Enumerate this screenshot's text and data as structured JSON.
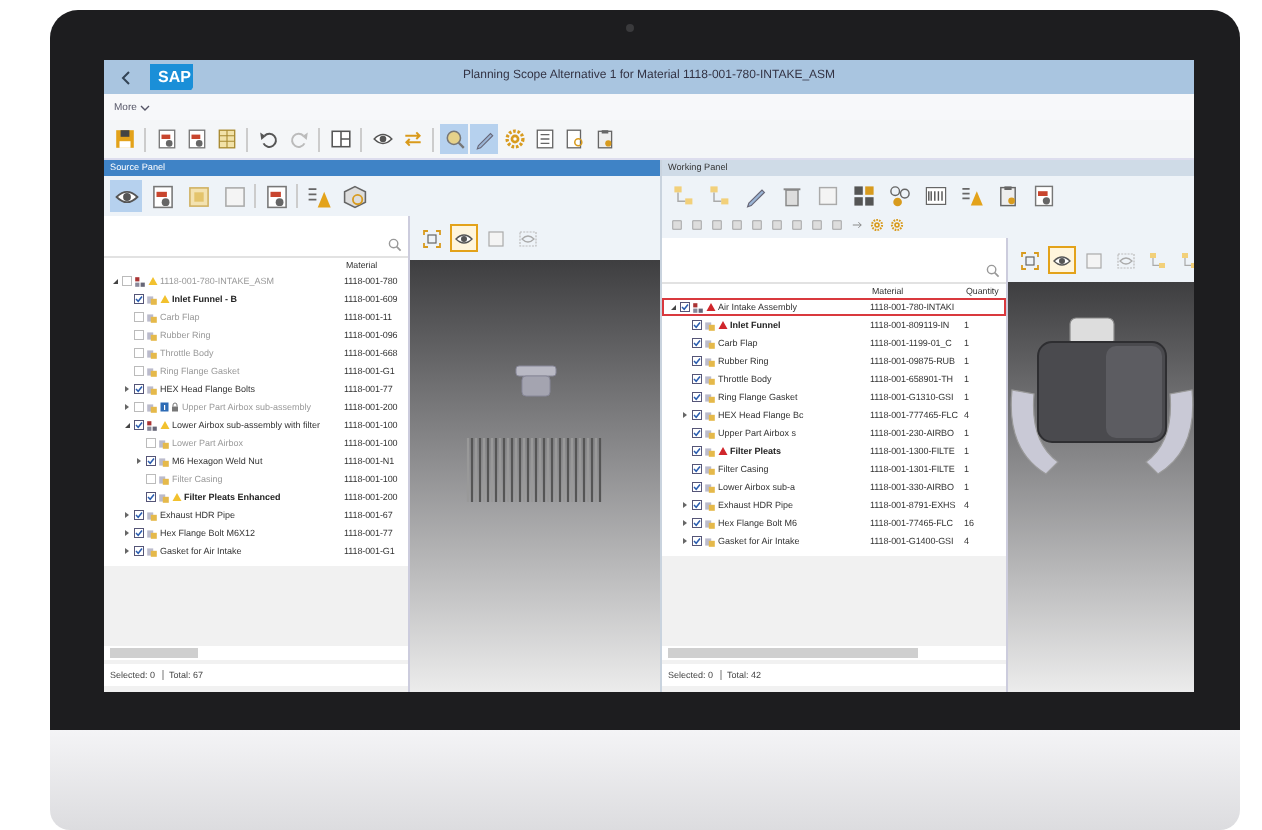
{
  "header": {
    "logo": "SAP",
    "title": "Planning Scope Alternative 1 for Material 1118-001-780-INTAKE_ASM"
  },
  "menu": {
    "more": "More"
  },
  "main_toolbar": [
    {
      "pressed": false
    },
    {
      "pressed": false
    },
    {
      "pressed": false
    },
    {
      "pressed": false
    },
    {
      "pressed": false
    },
    {
      "pressed": false
    },
    {
      "pressed": false
    },
    {
      "pressed": false
    },
    {
      "pressed": false
    },
    {
      "pressed": true
    },
    {
      "pressed": true
    },
    {
      "pressed": false
    },
    {
      "pressed": false
    },
    {
      "pressed": false
    },
    {
      "pressed": false
    }
  ],
  "source_panel": {
    "title": "Source Panel",
    "active": true,
    "toolbar": [
      {
        "pressed": true
      },
      {
        "pressed": false
      },
      {
        "pressed": false
      },
      {
        "pressed": false
      },
      {
        "pressed": false
      },
      {
        "pressed": false
      },
      {
        "pressed": false
      }
    ],
    "viewer_toolbar": [
      {
        "pressed": false
      },
      {
        "pressed": true
      },
      {
        "pressed": false
      },
      {
        "pressed": false
      }
    ],
    "columns": [
      "Material"
    ],
    "rows": [
      {
        "label": "1118-001-780-INTAKE_ASM",
        "material": "1118-001-780",
        "checked": false,
        "kind": "warning",
        "expanded": true,
        "children": [
          {
            "label": "Inlet Funnel - B",
            "material": "1118-001-609",
            "checked": true,
            "kind": "warning"
          },
          {
            "label": "Carb Flap",
            "material": "1118-001-11",
            "checked": false,
            "kind": "none"
          },
          {
            "label": "Rubber Ring",
            "material": "1118-001-096",
            "checked": false,
            "kind": "none"
          },
          {
            "label": "Throttle Body",
            "material": "1118-001-668",
            "checked": false,
            "kind": "none"
          },
          {
            "label": "Ring Flange Gasket",
            "material": "1118-001-G1",
            "checked": false,
            "kind": "none"
          },
          {
            "label": "HEX Head Flange Bolts",
            "material": "1118-001-77",
            "checked": true,
            "kind": "none",
            "expanded": false
          },
          {
            "label": "Upper Part Airbox sub-assembly",
            "material": "1118-001-200",
            "checked": false,
            "kind": "locked",
            "expanded": false
          },
          {
            "label": "Lower Airbox sub-assembly with filter",
            "material": "1118-001-100",
            "checked": true,
            "kind": "warning",
            "expanded": true,
            "children": [
              {
                "label": "Lower Part Airbox",
                "material": "1118-001-100",
                "checked": false,
                "kind": "none"
              },
              {
                "label": "M6 Hexagon Weld Nut",
                "material": "1118-001-N1",
                "checked": true,
                "kind": "none",
                "expanded": false
              },
              {
                "label": "Filter Casing",
                "material": "1118-001-100",
                "checked": false,
                "kind": "none"
              },
              {
                "label": "Filter Pleats Enhanced",
                "material": "1118-001-200",
                "checked": true,
                "kind": "warning"
              }
            ]
          },
          {
            "label": "Exhaust HDR Pipe",
            "material": "1118-001-67",
            "checked": true,
            "kind": "none",
            "expanded": false
          },
          {
            "label": "Hex Flange Bolt M6X12",
            "material": "1118-001-77",
            "checked": true,
            "kind": "none",
            "expanded": false
          },
          {
            "label": "Gasket for Air Intake",
            "material": "1118-001-G1",
            "checked": true,
            "kind": "none",
            "expanded": false
          }
        ]
      }
    ],
    "status": {
      "selected": "Selected: 0",
      "total": "Total: 67"
    }
  },
  "working_panel": {
    "title": "Working Panel",
    "active": false,
    "viewer_toolbar": [
      {
        "pressed": false
      },
      {
        "pressed": true
      },
      {
        "pressed": false
      },
      {
        "pressed": false
      },
      {
        "pressed": false
      },
      {
        "pressed": false
      }
    ],
    "columns": [
      "Material",
      "Quantity"
    ],
    "rows": [
      {
        "label": "Air Intake Assembly",
        "material": "1118-001-780-INTAKI",
        "checked": true,
        "kind": "error",
        "selected": true,
        "expanded": true,
        "children": [
          {
            "label": "Inlet Funnel",
            "material": "1118-001-809119-IN",
            "quantity": "1",
            "checked": true,
            "kind": "error",
            "selected": false
          },
          {
            "label": "Carb Flap",
            "material": "1118-001-1199-01_C",
            "quantity": "1",
            "checked": true,
            "kind": "none",
            "selected": false
          },
          {
            "label": "Rubber Ring",
            "material": "1118-001-09875-RUB",
            "quantity": "1",
            "checked": true,
            "kind": "none",
            "selected": false
          },
          {
            "label": "Throttle Body",
            "material": "1118-001-658901-TH",
            "quantity": "1",
            "checked": true,
            "kind": "none",
            "selected": false
          },
          {
            "label": "Ring Flange Gasket",
            "material": "1118-001-G1310-GSI",
            "quantity": "1",
            "checked": true,
            "kind": "none",
            "selected": false
          },
          {
            "label": "HEX Head Flange Bc",
            "material": "1118-001-777465-FLC",
            "quantity": "4",
            "checked": true,
            "kind": "none",
            "selected": false,
            "expanded": false
          },
          {
            "label": "Upper Part Airbox s",
            "material": "1118-001-230-AIRBO",
            "quantity": "1",
            "checked": true,
            "kind": "none",
            "selected": false
          },
          {
            "label": "Filter Pleats",
            "material": "1118-001-1300-FILTE",
            "quantity": "1",
            "checked": true,
            "kind": "error",
            "selected": false
          },
          {
            "label": "Filter Casing",
            "material": "1118-001-1301-FILTE",
            "quantity": "1",
            "checked": true,
            "kind": "none",
            "selected": false
          },
          {
            "label": "Lower Airbox sub-a",
            "material": "1118-001-330-AIRBO",
            "quantity": "1",
            "checked": true,
            "kind": "none",
            "selected": false
          },
          {
            "label": "Exhaust HDR Pipe",
            "material": "1118-001-8791-EXHS",
            "quantity": "4",
            "checked": true,
            "kind": "none",
            "selected": false,
            "expanded": false
          },
          {
            "label": "Hex Flange Bolt M6",
            "material": "1118-001-77465-FLC",
            "quantity": "16",
            "checked": true,
            "kind": "none",
            "selected": false,
            "expanded": false
          },
          {
            "label": "Gasket for Air Intake",
            "material": "1118-001-G1400-GSI",
            "quantity": "4",
            "checked": true,
            "kind": "none",
            "selected": false,
            "expanded": false
          }
        ]
      }
    ],
    "status": {
      "selected": "Selected: 0",
      "total": "Total: 42"
    }
  }
}
